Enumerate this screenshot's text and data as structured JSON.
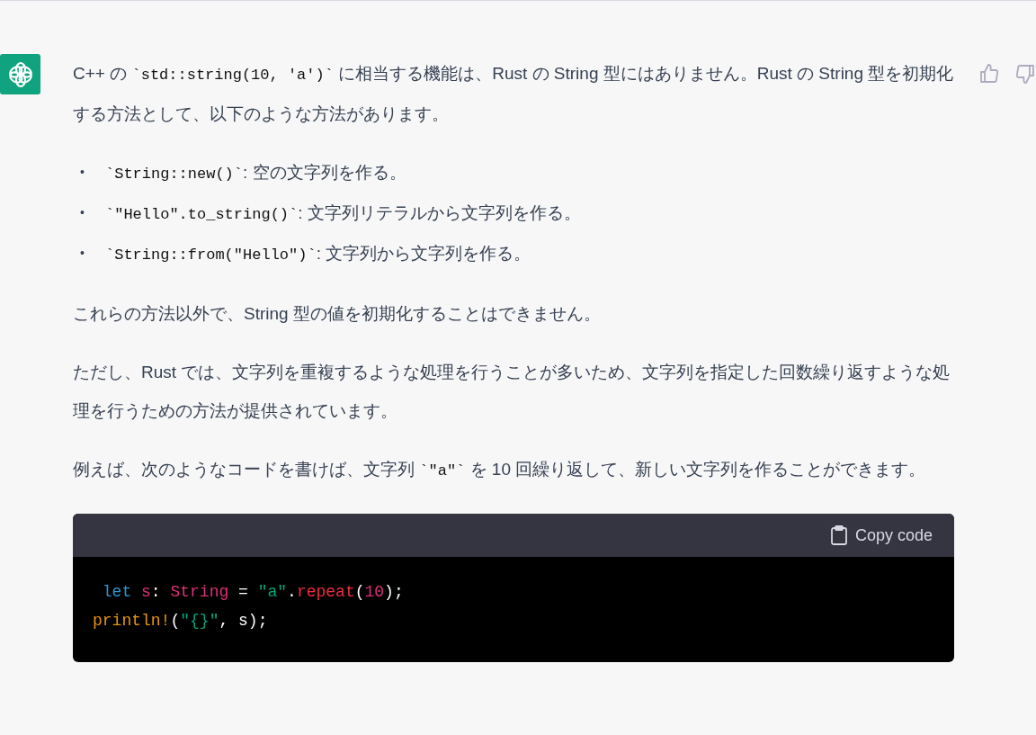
{
  "message": {
    "paragraphs_before": [
      {
        "segments": [
          {
            "kind": "text",
            "text": "C++ の "
          },
          {
            "kind": "code",
            "text": "`std::string(10, 'a')`"
          },
          {
            "kind": "text",
            "text": " に相当する機能は、Rust の String 型にはありません。Rust の String 型を初期化する方法として、以下のような方法があります。"
          }
        ]
      }
    ],
    "bullets": [
      {
        "marker": "•",
        "segments": [
          {
            "kind": "code",
            "text": "`String::new()`"
          },
          {
            "kind": "text",
            "text": ": 空の文字列を作る。"
          }
        ]
      },
      {
        "marker": "•",
        "segments": [
          {
            "kind": "code",
            "text": "`\"Hello\".to_string()`"
          },
          {
            "kind": "text",
            "text": ": 文字列リテラルから文字列を作る。"
          }
        ]
      },
      {
        "marker": "•",
        "segments": [
          {
            "kind": "code",
            "text": "`String::from(\"Hello\")`"
          },
          {
            "kind": "text",
            "text": ": 文字列から文字列を作る。"
          }
        ]
      }
    ],
    "paragraphs_after": [
      {
        "segments": [
          {
            "kind": "text",
            "text": "これらの方法以外で、String 型の値を初期化することはできません。"
          }
        ]
      },
      {
        "segments": [
          {
            "kind": "text",
            "text": "ただし、Rust では、文字列を重複するような処理を行うことが多いため、文字列を指定した回数繰り返すような処理を行うための方法が提供されています。"
          }
        ]
      },
      {
        "segments": [
          {
            "kind": "text",
            "text": "例えば、次のようなコードを書けば、文字列 "
          },
          {
            "kind": "code",
            "text": "`\"a\"`"
          },
          {
            "kind": "text",
            "text": " を 10 回繰り返して、新しい文字列を作ることができます。"
          }
        ]
      }
    ],
    "code_block": {
      "copy_label": "Copy code",
      "lines": [
        [
          {
            "kind": "keyword",
            "text": " let"
          },
          {
            "kind": "variable",
            "text": " s"
          },
          {
            "kind": "plain",
            "text": ": "
          },
          {
            "kind": "type",
            "text": "String"
          },
          {
            "kind": "plain",
            "text": " = "
          },
          {
            "kind": "string",
            "text": "\"a\""
          },
          {
            "kind": "plain",
            "text": "."
          },
          {
            "kind": "function",
            "text": "repeat"
          },
          {
            "kind": "plain",
            "text": "("
          },
          {
            "kind": "number",
            "text": "10"
          },
          {
            "kind": "plain",
            "text": ");"
          }
        ],
        [
          {
            "kind": "macro",
            "text": "println!"
          },
          {
            "kind": "plain",
            "text": "("
          },
          {
            "kind": "string",
            "text": "\"{}\""
          },
          {
            "kind": "plain",
            "text": ", s);"
          }
        ]
      ]
    }
  }
}
